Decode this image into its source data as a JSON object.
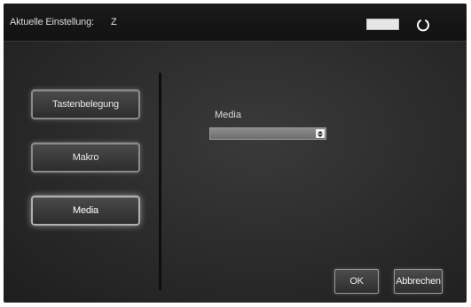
{
  "titlebar": {
    "label": "Aktuelle Einstellung:",
    "value": "Z"
  },
  "sidebar": {
    "items": [
      {
        "label": "Tastenbelegung",
        "active": false
      },
      {
        "label": "Makro",
        "active": false
      },
      {
        "label": "Media",
        "active": true
      }
    ]
  },
  "main": {
    "field_label": "Media",
    "select_value": ""
  },
  "footer": {
    "ok_label": "OK",
    "cancel_label": "Abbrechen"
  }
}
